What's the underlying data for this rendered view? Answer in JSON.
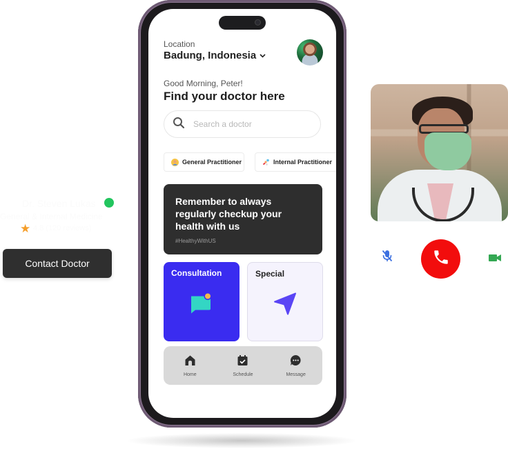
{
  "left_panel": {
    "doctor_name": "Dr. Steven Lukas",
    "doctor_specialty": "General & Internal Medicine",
    "rating_text": "4.8 (120 reviews)",
    "online_status_color": "#22c55e",
    "star_color": "#f59e2a",
    "contact_button_label": "Contact Doctor"
  },
  "phone": {
    "location_label": "Location",
    "location_value": "Badung, Indonesia",
    "location_dropdown_icon": "chevron-down-icon",
    "greeting": "Good Morning, Peter!",
    "headline": "Find your doctor here",
    "search": {
      "placeholder": "Search a doctor",
      "value": ""
    },
    "categories": [
      {
        "label": "General Practitioner",
        "icon": "doctor-avatar-icon"
      },
      {
        "label": "Internal Practitioner",
        "icon": "pills-icon"
      }
    ],
    "banner": {
      "title": "Remember to always regularly checkup your health with us",
      "tag": "#HealthyWithUS"
    },
    "cards": [
      {
        "title": "Consultation",
        "icon": "chat-bubble-icon",
        "color": "#3a2cf0"
      },
      {
        "title": "Special",
        "icon": "navigation-arrow-icon",
        "color": "#f5f3fd"
      }
    ],
    "bottom_nav": [
      {
        "label": "Home",
        "icon": "home-icon"
      },
      {
        "label": "Schedule",
        "icon": "calendar-check-icon"
      },
      {
        "label": "Message",
        "icon": "chat-dots-icon"
      }
    ]
  },
  "video_call": {
    "mute_icon": "mic-off-icon",
    "end_call_icon": "phone-icon",
    "end_call_color": "#f20d0d",
    "camera_icon": "video-camera-icon",
    "camera_color": "#34a853",
    "mute_color": "#3b6fe0"
  }
}
